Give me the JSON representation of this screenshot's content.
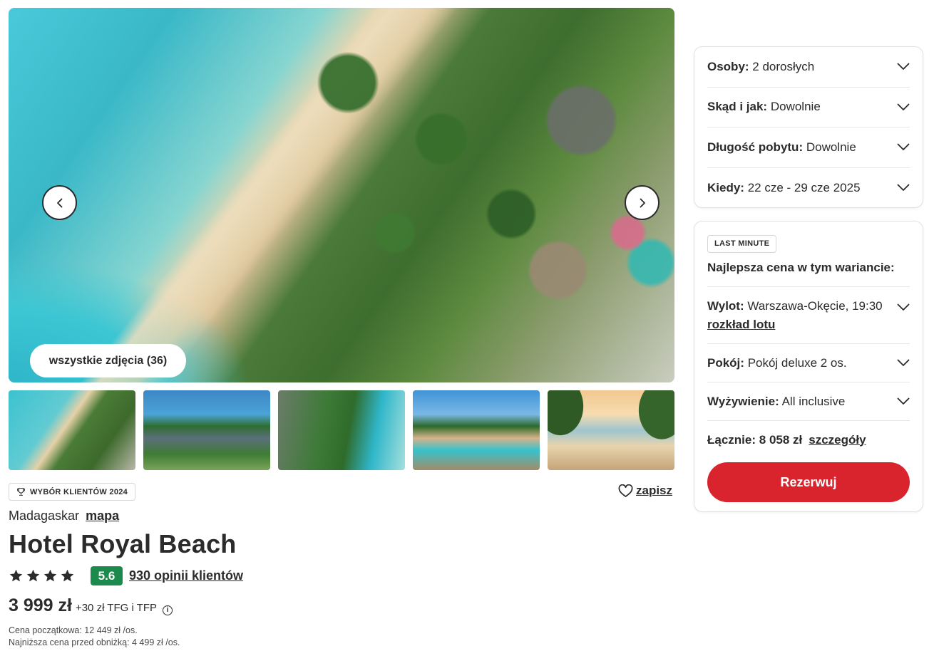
{
  "gallery": {
    "all_photos_label": "wszystkie zdjęcia (36)",
    "thumbnails": [
      "beach-aerial",
      "hotel-buildings-aerial",
      "resort-aerial-coast",
      "pool-area",
      "beach-palms-sunset"
    ]
  },
  "hotel": {
    "award_badge": "WYBÓR KLIENTÓW 2024",
    "save_label": "zapisz",
    "country": "Madagaskar",
    "map_link": "mapa",
    "name": "Hotel Royal Beach",
    "stars": 4,
    "score": "5.6",
    "reviews_label": "930 opinii klientów",
    "price": "3 999 zł",
    "fees": "+30 zł TFG i TFP",
    "initial_price": "Cena początkowa: 12 449 zł /os.",
    "lowest_price": "Najniższa cena przed obniżką: 4 499 zł /os."
  },
  "filters": [
    {
      "label": "Osoby:",
      "value": "2 dorosłych"
    },
    {
      "label": "Skąd i jak:",
      "value": "Dowolnie"
    },
    {
      "label": "Długość pobytu:",
      "value": "Dowolnie"
    },
    {
      "label": "Kiedy:",
      "value": "22 cze - 29 cze 2025"
    }
  ],
  "offer": {
    "badge": "LAST MINUTE",
    "heading": "Najlepsza cena w tym wariancie:",
    "flight_label": "Wylot:",
    "flight_value": "Warszawa-Okęcie, 19:30",
    "flight_schedule_link": "rozkład lotu",
    "room_label": "Pokój:",
    "room_value": "Pokój deluxe 2 os.",
    "board_label": "Wyżywienie:",
    "board_value": "All inclusive",
    "total_label": "Łącznie:",
    "total_value": "8 058 zł",
    "details_link": "szczegóły",
    "book_label": "Rezerwuj"
  },
  "colors": {
    "accent_red": "#d9232d",
    "score_green": "#1c8a4c",
    "text_dark": "#2b2b2b"
  }
}
